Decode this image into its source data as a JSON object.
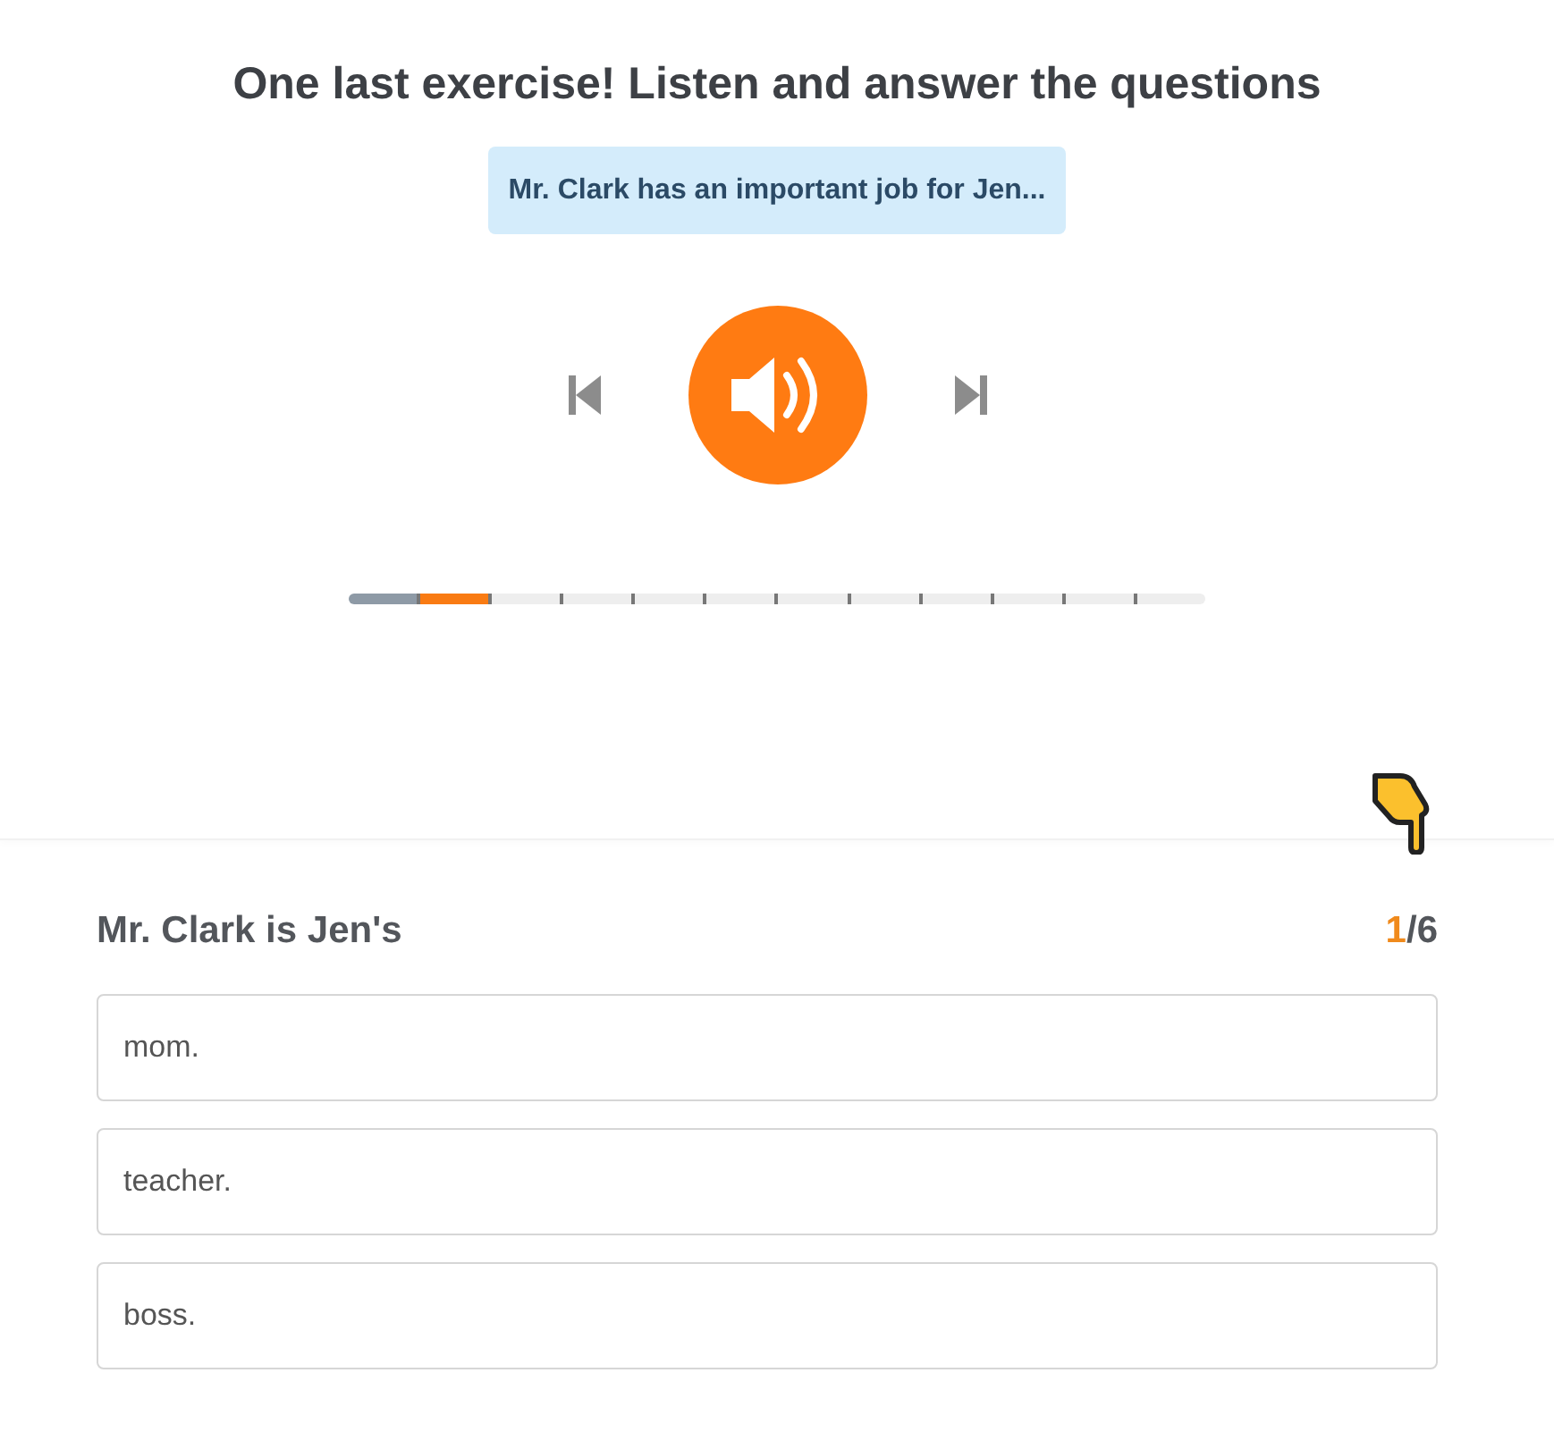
{
  "title": "One last exercise! Listen and answer the questions",
  "caption": "Mr. Clark has an important job for Jen...",
  "player": {
    "playing": false
  },
  "progress": [
    {
      "completed": true,
      "selected": false
    },
    {
      "completed": false,
      "selected": true
    },
    {
      "completed": false,
      "selected": false
    },
    {
      "completed": false,
      "selected": false
    },
    {
      "completed": false,
      "selected": false
    },
    {
      "completed": false,
      "selected": false
    },
    {
      "completed": false,
      "selected": false
    },
    {
      "completed": false,
      "selected": false
    },
    {
      "completed": false,
      "selected": false
    },
    {
      "completed": false,
      "selected": false
    },
    {
      "completed": false,
      "selected": false
    },
    {
      "completed": false,
      "selected": false
    }
  ],
  "question": {
    "text": "Mr. Clark is Jen's",
    "current": "1",
    "total": "/6"
  },
  "answers": [
    {
      "text": "mom.",
      "selected": false
    },
    {
      "text": "teacher.",
      "selected": false
    },
    {
      "text": "boss.",
      "selected": false
    }
  ]
}
